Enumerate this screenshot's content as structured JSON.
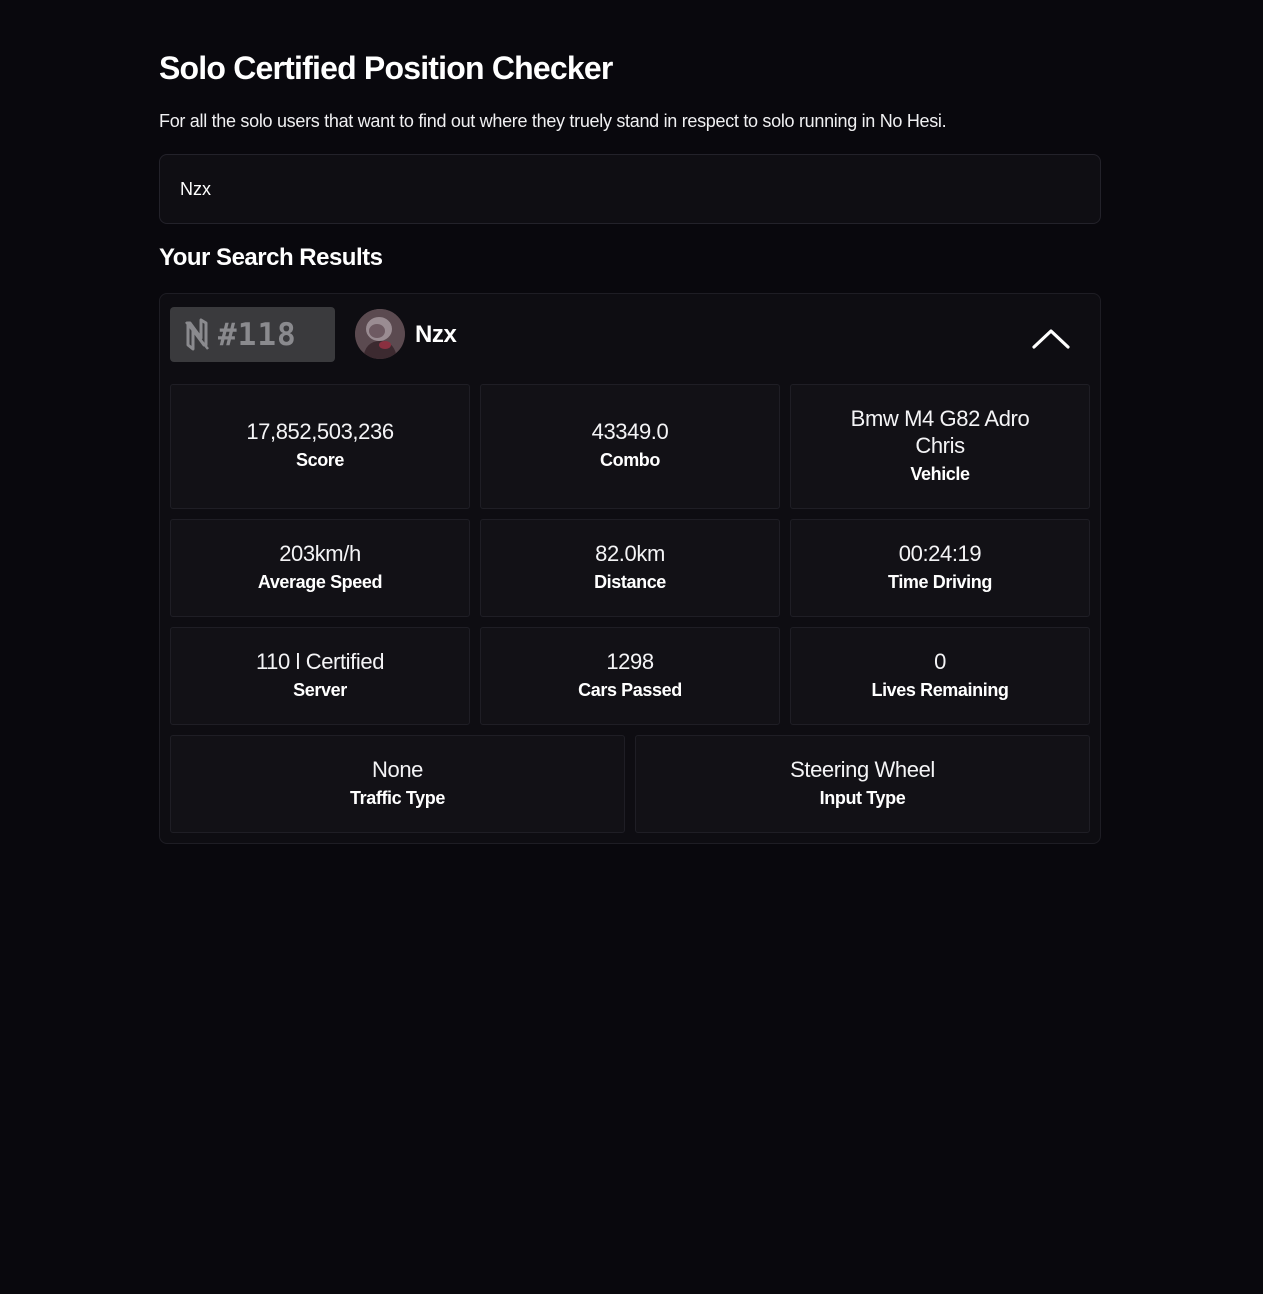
{
  "header": {
    "title": "Solo Certified Position Checker",
    "subtitle": "For all the solo users that want to find out where they truely stand in respect to solo running in No Hesi."
  },
  "search": {
    "value": "Nzx",
    "placeholder": ""
  },
  "results": {
    "title": "Your Search Results",
    "player": {
      "rank": "#118",
      "name": "Nzx",
      "avatar_icon": "player-avatar"
    },
    "stats": [
      {
        "value": "17,852,503,236",
        "label": "Score"
      },
      {
        "value": "43349.0",
        "label": "Combo"
      },
      {
        "value": "Bmw M4 G82 Adro Chris",
        "label": "Vehicle"
      },
      {
        "value": "203km/h",
        "label": "Average Speed"
      },
      {
        "value": "82.0km",
        "label": "Distance"
      },
      {
        "value": "00:24:19",
        "label": "Time Driving"
      },
      {
        "value": "110 l Certified",
        "label": "Server"
      },
      {
        "value": "1298",
        "label": "Cars Passed"
      },
      {
        "value": "0",
        "label": "Lives Remaining"
      },
      {
        "value": "None",
        "label": "Traffic Type"
      },
      {
        "value": "Steering Wheel",
        "label": "Input Type"
      }
    ]
  },
  "icons": {
    "rank": "nohesi-logo-icon",
    "collapse": "chevron-up-icon"
  },
  "colors": {
    "background": "#09080d",
    "card": "#0e0d12",
    "stat_box": "#121116",
    "rank_badge": "#3a3a3d",
    "rank_text": "#8a8a8e"
  }
}
